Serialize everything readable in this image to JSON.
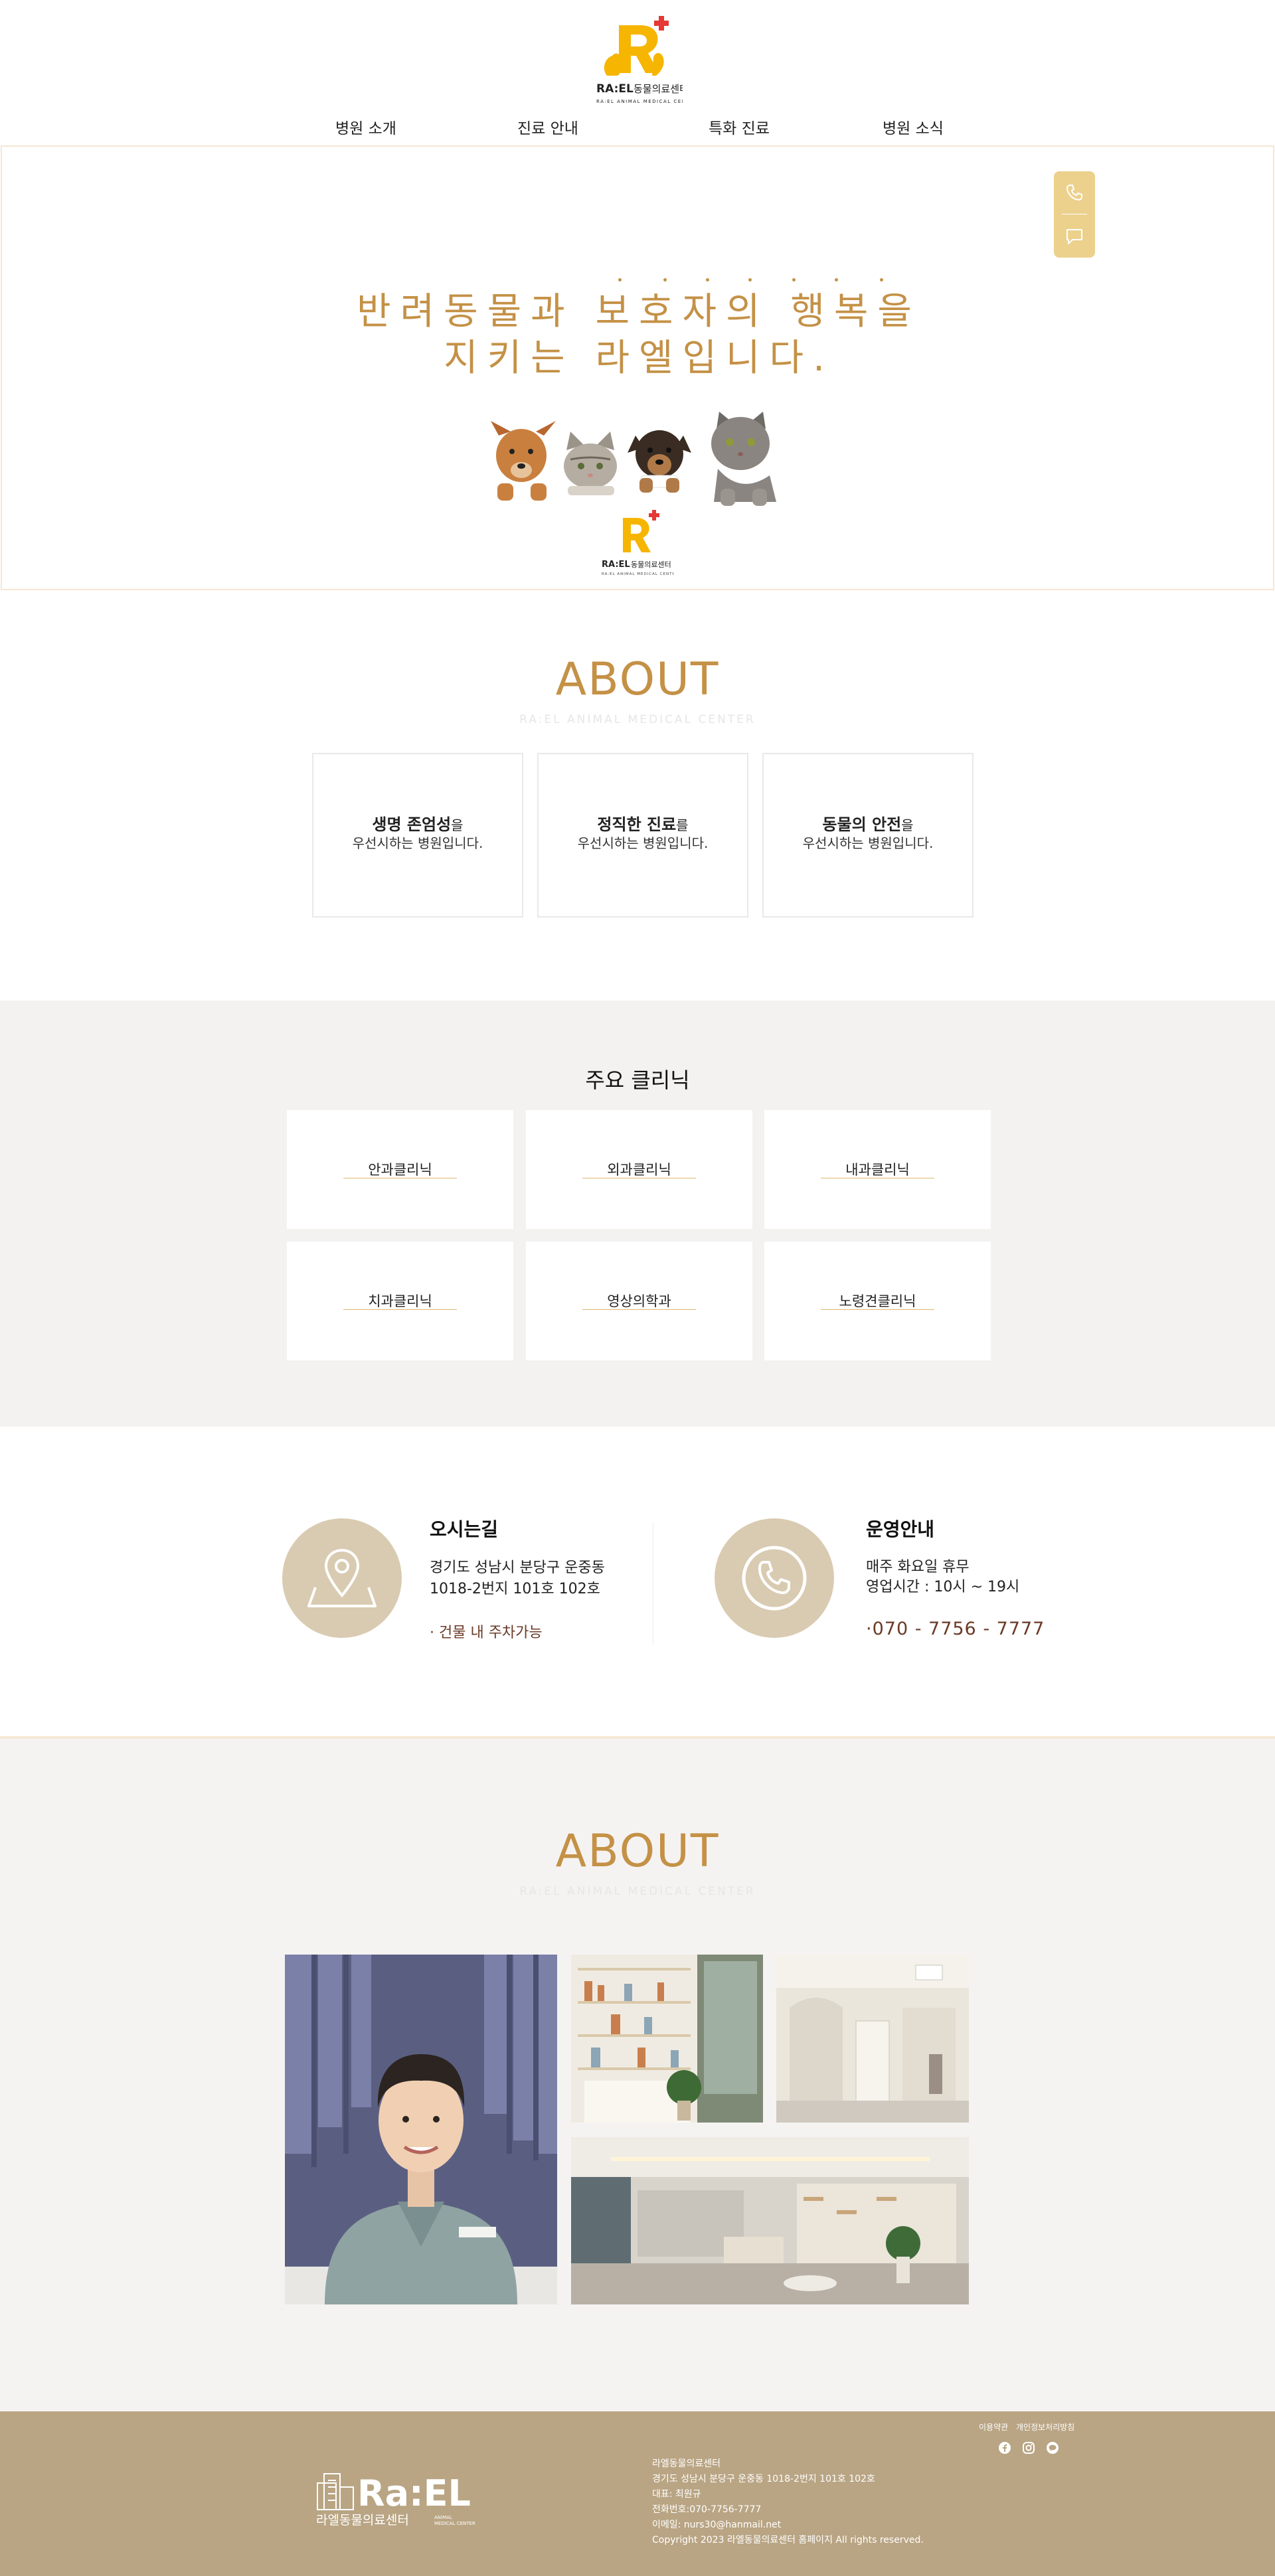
{
  "brand": {
    "logo_text": "RA:EL",
    "logo_korean": "동물의료센터",
    "logo_tagline": "RA:EL ANIMAL MEDICAL CENTER",
    "brand_color": "#f6b500",
    "cross_color": "#e53935"
  },
  "nav": {
    "items": [
      "병원 소개",
      "진료 안내",
      "특화 진료",
      "병원 소식"
    ]
  },
  "hero": {
    "line1": "반려동물과 보호자의 행복을",
    "line2": "지키는 라엘입니다.",
    "accent_color": "#c49146",
    "quick_buttons": [
      "phone-icon",
      "chat-icon"
    ]
  },
  "about": {
    "title": "ABOUT",
    "subtitle": "RA:EL ANIMAL MEDICAL CENTER",
    "values": [
      {
        "bold": "생명 존엄성",
        "rest": "을",
        "line2": "우선시하는 병원입니다."
      },
      {
        "bold": "정직한 진료",
        "rest": "를",
        "line2": "우선시하는 병원입니다."
      },
      {
        "bold": "동물의 안전",
        "rest": "을",
        "line2": "우선시하는 병원입니다."
      }
    ]
  },
  "clinics": {
    "title": "주요 클리닉",
    "items": [
      "안과클리닉",
      "외과클리닉",
      "내과클리닉",
      "치과클리닉",
      "영상의학과",
      "노령견클리닉"
    ]
  },
  "info": {
    "location": {
      "title": "오시는길",
      "address1": "경기도 성남시 분당구 운중동",
      "address2": "1018-2번지 101호 102호",
      "note": "· 건물 내 주차가능"
    },
    "hours": {
      "title": "운영안내",
      "line1": "매주 화요일 휴무",
      "line2": "영업시간 : 10시 ~ 19시",
      "phone": "·070 - 7756 - 7777"
    }
  },
  "about2": {
    "title": "ABOUT",
    "subtitle": "RA:EL ANIMAL MEDICAL CENTER",
    "photos": [
      "doctor-photo",
      "pharmacy-shelves-photo",
      "hallway-photo",
      "lobby-photo"
    ]
  },
  "footer": {
    "links": [
      "이용약관",
      "개인정보처리방침"
    ],
    "social": [
      "facebook-icon",
      "instagram-icon",
      "talk-icon"
    ],
    "logo_text": "Ra:EL",
    "logo_korean": "라엘동물의료센터",
    "logo_small1": "ANIMAL",
    "logo_small2": "MEDICAL CENTER",
    "info": [
      "라엘동물의료센터",
      "경기도 성남시 분당구 운중동 1018-2번지 101호 102호",
      "대표: 최원규",
      "전화번호:070-7756-7777",
      "이메일: nurs30@hanmail.net",
      "Copyright 2023 라엘동물의료센터 홈페이지 All rights reserved."
    ],
    "bg_color": "#b9a584"
  }
}
